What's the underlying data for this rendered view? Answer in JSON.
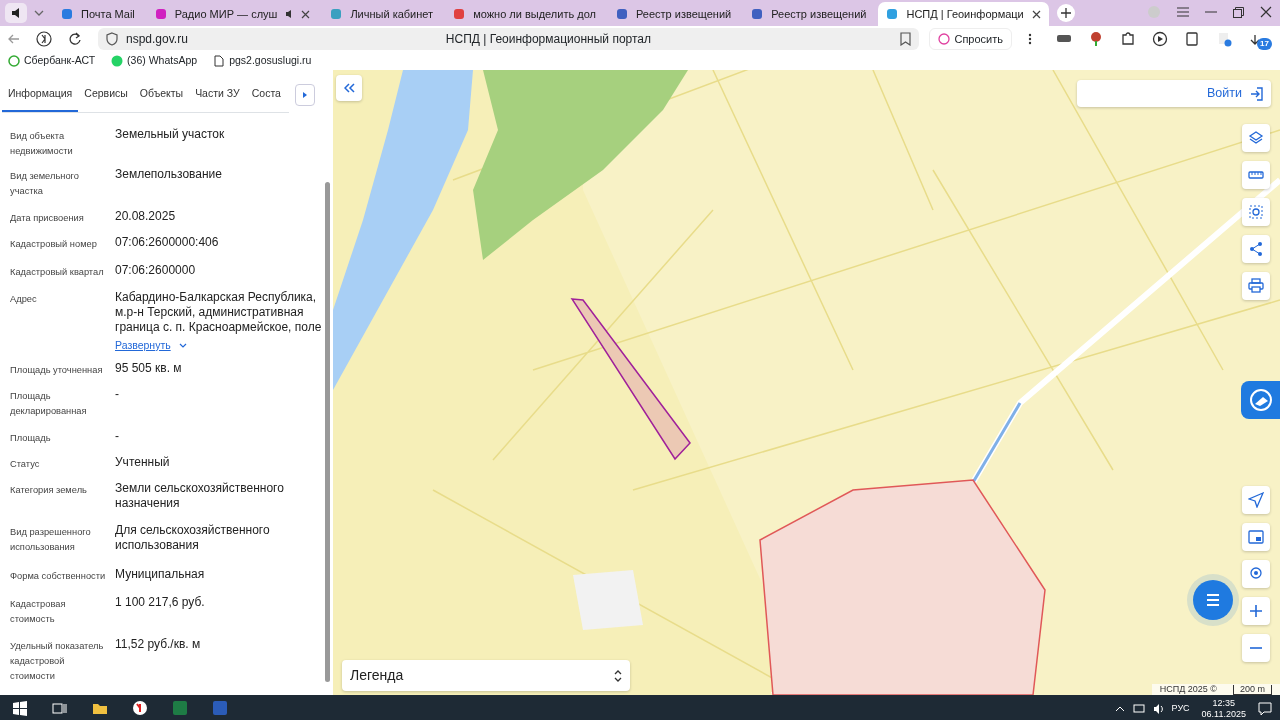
{
  "browser": {
    "tabs": [
      {
        "title": "Почта Mail",
        "selected": false,
        "audio": false
      },
      {
        "title": "Радио МИР — слуш",
        "selected": false,
        "audio": true
      },
      {
        "title": "Личный кабинет",
        "selected": false,
        "audio": false
      },
      {
        "title": "можно ли выделить дол",
        "selected": false,
        "audio": false
      },
      {
        "title": "Реестр извещений",
        "selected": false,
        "audio": false
      },
      {
        "title": "Реестр извещений",
        "selected": false,
        "audio": false
      },
      {
        "title": "НСПД | Геоинформаци",
        "selected": true,
        "audio": false
      }
    ],
    "url": "nspd.gov.ru",
    "page_title": "НСПД | Геоинформационный портал",
    "ask_button": "Спросить",
    "downloads_badge": "17",
    "bookmarks": [
      "Сбербанк-АСТ",
      "(36) WhatsApp",
      "pgs2.gosuslugi.ru"
    ]
  },
  "panel": {
    "tabs": [
      {
        "label": "Информация",
        "selected": true
      },
      {
        "label": "Сервисы",
        "selected": false
      },
      {
        "label": "Объекты",
        "selected": false
      },
      {
        "label": "Части ЗУ",
        "selected": false
      },
      {
        "label": "Соста",
        "selected": false
      }
    ],
    "fields": [
      {
        "label": "Вид объекта недвижимости",
        "value": "Земельный участок"
      },
      {
        "label": "Вид земельного участка",
        "value": "Землепользование"
      },
      {
        "label": "Дата присвоения",
        "value": "20.08.2025"
      },
      {
        "label": "Кадастровый номер",
        "value": "07:06:2600000:406"
      },
      {
        "label": "Кадастровый квартал",
        "value": "07:06:2600000"
      },
      {
        "label": "Адрес",
        "value": "Кабардино-Балкарская Республика, м.р-н Терский, административная граница с. п. Красноармейское, поле",
        "expand_link": "Развернуть"
      },
      {
        "label": "Площадь уточненная",
        "value": "95 505 кв. м"
      },
      {
        "label": "Площадь декларированная",
        "value": "-"
      },
      {
        "label": "Площадь",
        "value": "-"
      },
      {
        "label": "Статус",
        "value": "Учтенный"
      },
      {
        "label": "Категория земель",
        "value": "Земли сельскохозяйственного назначения"
      },
      {
        "label": "Вид разрешенного использования",
        "value": "Для сельскохозяйственного использования"
      },
      {
        "label": "Форма собственности",
        "value": "Муниципальная"
      },
      {
        "label": "Кадастровая стоимость",
        "value": "1 100 217,6 руб."
      },
      {
        "label": "Удельный показатель кадастровой стоимости",
        "value": "11,52 руб./кв. м"
      }
    ]
  },
  "map": {
    "login_button": "Войти",
    "legend": "Легенда",
    "attribution": "НСПД 2025 ©",
    "scale": "200 m"
  },
  "taskbar": {
    "language": "РУС",
    "time": "12:35",
    "date": "06.11.2025"
  }
}
